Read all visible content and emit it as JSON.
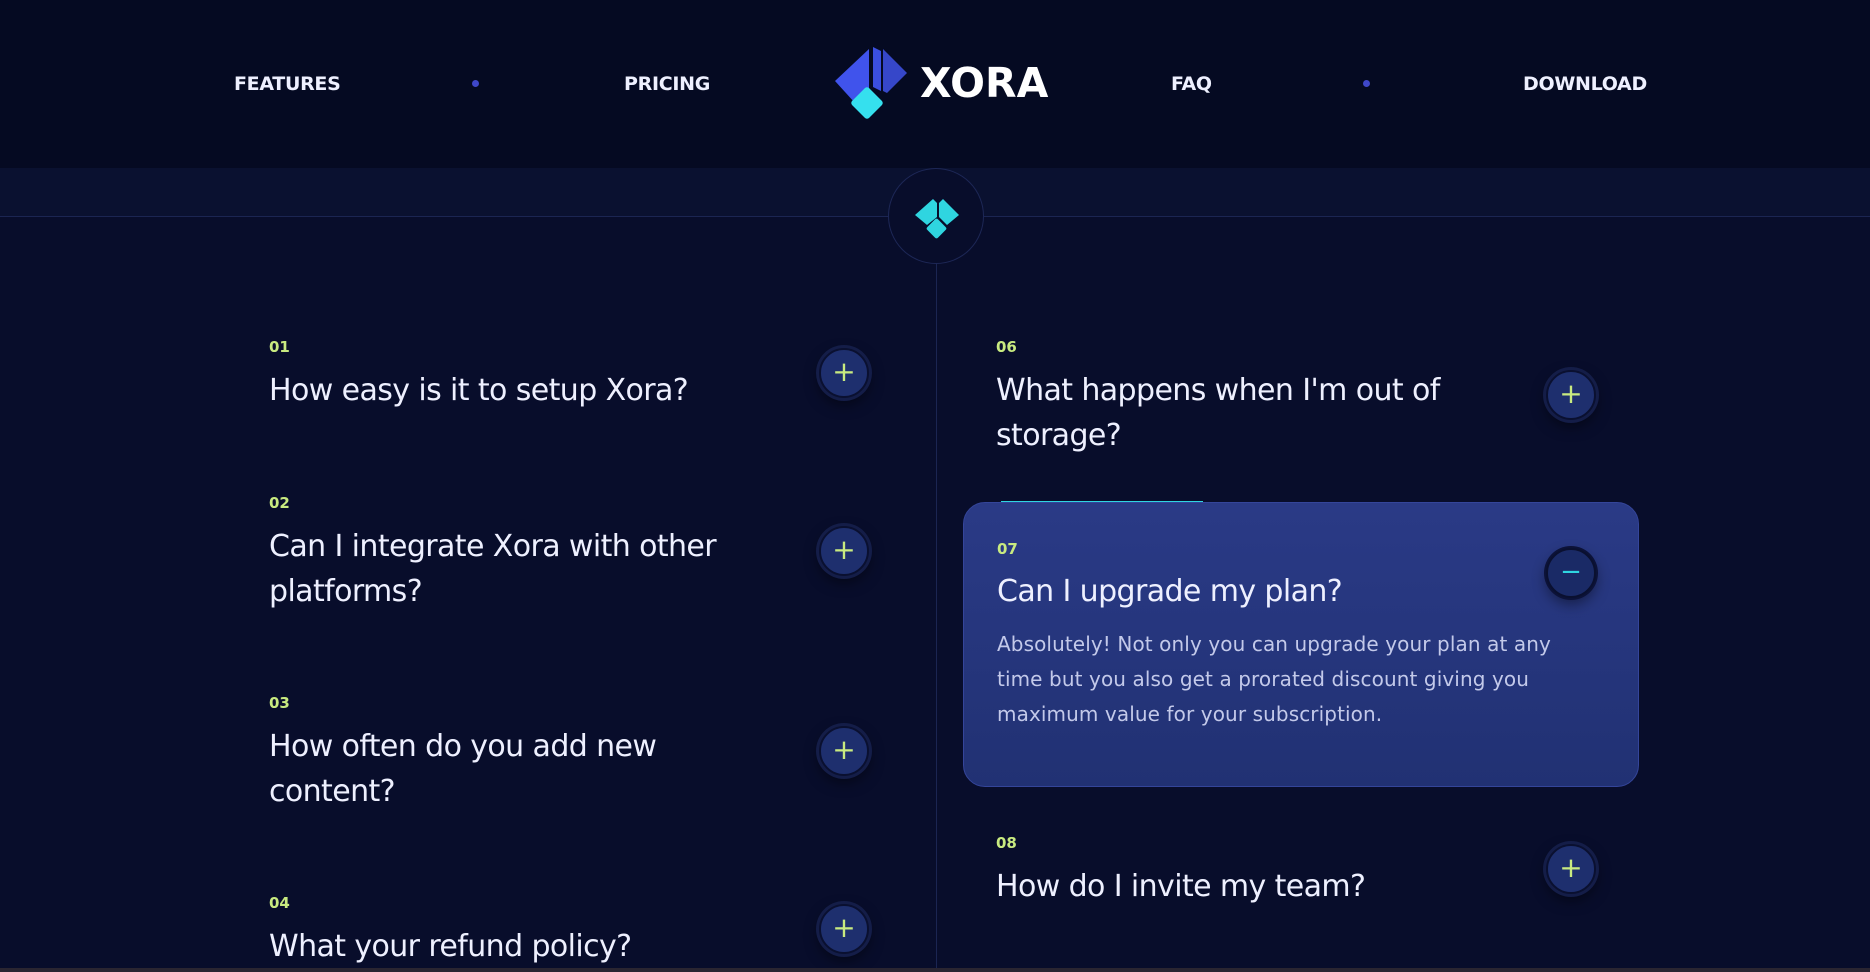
{
  "nav": {
    "left_links": [
      "FEATURES",
      "PRICING"
    ],
    "right_links": [
      "FAQ",
      "DOWNLOAD"
    ],
    "brand": "XORA"
  },
  "faq": {
    "left": [
      {
        "num": "01",
        "question": "How easy is it to setup Xora?"
      },
      {
        "num": "02",
        "question": "Can I integrate Xora with other platforms?"
      },
      {
        "num": "03",
        "question": "How often do you add new content?"
      },
      {
        "num": "04",
        "question": "What your refund policy?"
      }
    ],
    "right": [
      {
        "num": "06",
        "question": "What happens when I'm out of storage?"
      },
      {
        "num": "07",
        "question": "Can I upgrade my plan?",
        "answer": "Absolutely! Not only you can upgrade your plan at any time but you also get a prorated discount giving you maximum value for your subscription.",
        "open": true
      },
      {
        "num": "08",
        "question": "How do I invite my team?"
      }
    ],
    "expand_glyph": "+",
    "collapse_glyph": "−"
  },
  "colors": {
    "accent_lime": "#c8ea80",
    "accent_cyan": "#2fd5e0",
    "logo_blue": "#3b4fe0",
    "background": "#080d2b",
    "open_card": "#2a3a86"
  },
  "icons": {
    "brand_logo": "xora-logo-icon",
    "center_badge": "xora-mark-icon"
  }
}
